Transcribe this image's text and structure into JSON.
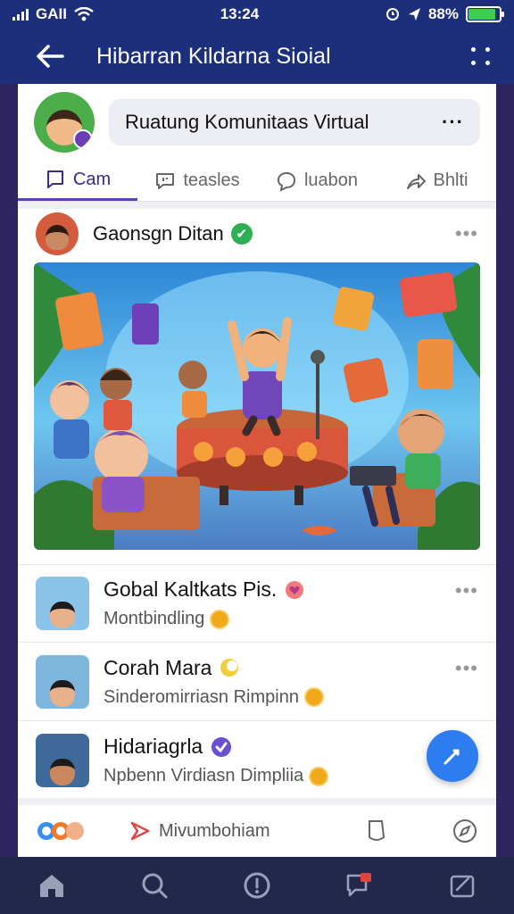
{
  "status_bar": {
    "carrier": "GAII",
    "time": "13:24",
    "battery_percent": "88%"
  },
  "app_bar": {
    "title": "Hibarran Kildarna Sioial"
  },
  "room": {
    "name": "Ruatung Komunitaas Virtual"
  },
  "tabs": [
    {
      "label": "Cam",
      "icon": "chat-square-icon"
    },
    {
      "label": "teasles",
      "icon": "message-icon"
    },
    {
      "label": "luabon",
      "icon": "bubble-icon"
    },
    {
      "label": "Bhlti",
      "icon": "share-icon"
    }
  ],
  "post": {
    "author": "Gaonsgn Ditan"
  },
  "users": [
    {
      "name": "Gobal Kaltkats Pis.",
      "subtitle": "Montbindling"
    },
    {
      "name": "Corah Mara",
      "subtitle": "Sinderomirriasn Rimpinn"
    },
    {
      "name": "Hidariagrla",
      "subtitle": "Npbenn Virdiasn Dimpliia"
    }
  ],
  "bottom_strip": {
    "label": "Mivumbohiam"
  },
  "colors": {
    "header": "#1d2f7a",
    "accent": "#5b3fbf",
    "fab": "#2d7df0",
    "nav": "#23284a"
  }
}
